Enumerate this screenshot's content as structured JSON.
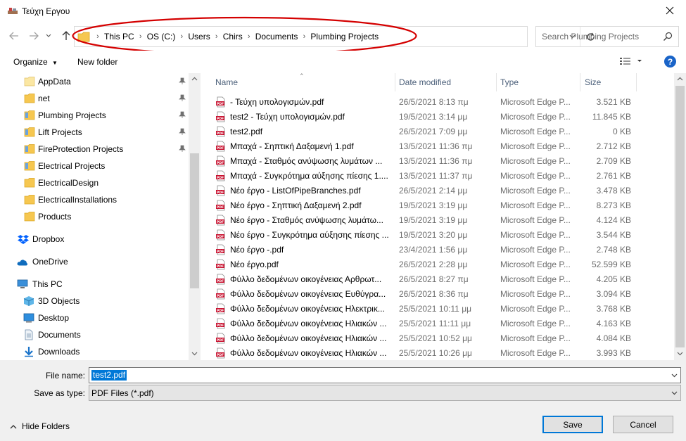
{
  "window": {
    "title": "Τεύχη Εργου"
  },
  "address": {
    "crumbs": [
      "This PC",
      "OS (C:)",
      "Users",
      "Chirs",
      "Documents",
      "Plumbing Projects"
    ]
  },
  "search": {
    "placeholder": "Search Plumbing Projects"
  },
  "toolbar": {
    "organize_label": "Organize",
    "new_folder_label": "New folder",
    "help_label": "?"
  },
  "sidebar": {
    "items": [
      {
        "label": "AppData",
        "icon": "folder-icon",
        "pinned": true
      },
      {
        "label": "net",
        "icon": "folder-icon",
        "pinned": true
      },
      {
        "label": "Plumbing Projects",
        "icon": "folder-icon",
        "pinned": true
      },
      {
        "label": "Lift Projects",
        "icon": "folder-icon",
        "pinned": true
      },
      {
        "label": "FireProtection Projects",
        "icon": "folder-icon",
        "pinned": true
      },
      {
        "label": "Electrical Projects",
        "icon": "folder-icon",
        "pinned": false
      },
      {
        "label": "ElectricalDesign",
        "icon": "folder-icon",
        "pinned": false
      },
      {
        "label": "ElectricalInstallations",
        "icon": "folder-icon",
        "pinned": false
      },
      {
        "label": "Products",
        "icon": "folder-icon",
        "pinned": false
      },
      {
        "label": "Dropbox",
        "icon": "dropbox-icon",
        "pinned": false
      },
      {
        "label": "OneDrive",
        "icon": "onedrive-icon",
        "pinned": false
      },
      {
        "label": "This PC",
        "icon": "computer-icon",
        "pinned": false
      },
      {
        "label": "3D Objects",
        "icon": "cube-icon",
        "pinned": false
      },
      {
        "label": "Desktop",
        "icon": "desktop-icon",
        "pinned": false
      },
      {
        "label": "Documents",
        "icon": "documents-icon",
        "pinned": false
      },
      {
        "label": "Downloads",
        "icon": "download-icon",
        "pinned": false
      }
    ]
  },
  "columns": {
    "name": "Name",
    "date": "Date modified",
    "type": "Type",
    "size": "Size"
  },
  "files": [
    {
      "name": "- Τεύχη υπολογισμών.pdf",
      "date": "26/5/2021 8:13 πμ",
      "type": "Microsoft Edge P...",
      "size": "3.521 KB"
    },
    {
      "name": "test2 - Τεύχη υπολογισμών.pdf",
      "date": "19/5/2021 3:14 μμ",
      "type": "Microsoft Edge P...",
      "size": "11.845 KB"
    },
    {
      "name": "test2.pdf",
      "date": "26/5/2021 7:09 μμ",
      "type": "Microsoft Edge P...",
      "size": "0 KB"
    },
    {
      "name": "Μπαχά - Σηπτική Δαξαμενή 1.pdf",
      "date": "13/5/2021 11:36 πμ",
      "type": "Microsoft Edge P...",
      "size": "2.712 KB"
    },
    {
      "name": "Μπαχά - Σταθμός ανύψωσης λυμάτων ...",
      "date": "13/5/2021 11:36 πμ",
      "type": "Microsoft Edge P...",
      "size": "2.709 KB"
    },
    {
      "name": "Μπαχά - Συγκρότημα αύξησης πίεσης 1....",
      "date": "13/5/2021 11:37 πμ",
      "type": "Microsoft Edge P...",
      "size": "2.761 KB"
    },
    {
      "name": "Νέο έργο - ListOfPipeBranches.pdf",
      "date": "26/5/2021 2:14 μμ",
      "type": "Microsoft Edge P...",
      "size": "3.478 KB"
    },
    {
      "name": "Νέο έργο - Σηπτική Δαξαμενή 2.pdf",
      "date": "19/5/2021 3:19 μμ",
      "type": "Microsoft Edge P...",
      "size": "8.273 KB"
    },
    {
      "name": "Νέο έργο - Σταθμός ανύψωσης λυμάτω...",
      "date": "19/5/2021 3:19 μμ",
      "type": "Microsoft Edge P...",
      "size": "4.124 KB"
    },
    {
      "name": "Νέο έργο - Συγκρότημα αύξησης πίεσης ...",
      "date": "19/5/2021 3:20 μμ",
      "type": "Microsoft Edge P...",
      "size": "3.544 KB"
    },
    {
      "name": "Νέο έργο -.pdf",
      "date": "23/4/2021 1:56 μμ",
      "type": "Microsoft Edge P...",
      "size": "2.748 KB"
    },
    {
      "name": "Νέο έργο.pdf",
      "date": "26/5/2021 2:28 μμ",
      "type": "Microsoft Edge P...",
      "size": "52.599 KB"
    },
    {
      "name": "Φύλλο δεδομένων οικογένειας Αρθρωτ...",
      "date": "26/5/2021 8:27 πμ",
      "type": "Microsoft Edge P...",
      "size": "4.205 KB"
    },
    {
      "name": "Φύλλο δεδομένων οικογένειας Ευθύγρα...",
      "date": "26/5/2021 8:36 πμ",
      "type": "Microsoft Edge P...",
      "size": "3.094 KB"
    },
    {
      "name": "Φύλλο δεδομένων οικογένειας Ηλεκτρικ...",
      "date": "25/5/2021 10:11 μμ",
      "type": "Microsoft Edge P...",
      "size": "3.768 KB"
    },
    {
      "name": "Φύλλο δεδομένων οικογένειας Ηλιακών ...",
      "date": "25/5/2021 11:11 μμ",
      "type": "Microsoft Edge P...",
      "size": "4.163 KB"
    },
    {
      "name": "Φύλλο δεδομένων οικογένειας Ηλιακών ...",
      "date": "25/5/2021 10:52 μμ",
      "type": "Microsoft Edge P...",
      "size": "4.084 KB"
    },
    {
      "name": "Φύλλο δεδομένων οικογένειας Ηλιακών ...",
      "date": "25/5/2021 10:26 μμ",
      "type": "Microsoft Edge P...",
      "size": "3.993 KB"
    }
  ],
  "bottom": {
    "file_name_label": "File name:",
    "file_name_value": "test2.pdf",
    "save_type_label": "Save as type:",
    "save_type_value": "PDF Files (*.pdf)",
    "hide_folders_label": "Hide Folders",
    "save_label": "Save",
    "cancel_label": "Cancel"
  },
  "colors": {
    "accent": "#0078d7",
    "annotation": "#d40000",
    "pdf_red": "#c8102e",
    "folder": "#f6c750"
  }
}
